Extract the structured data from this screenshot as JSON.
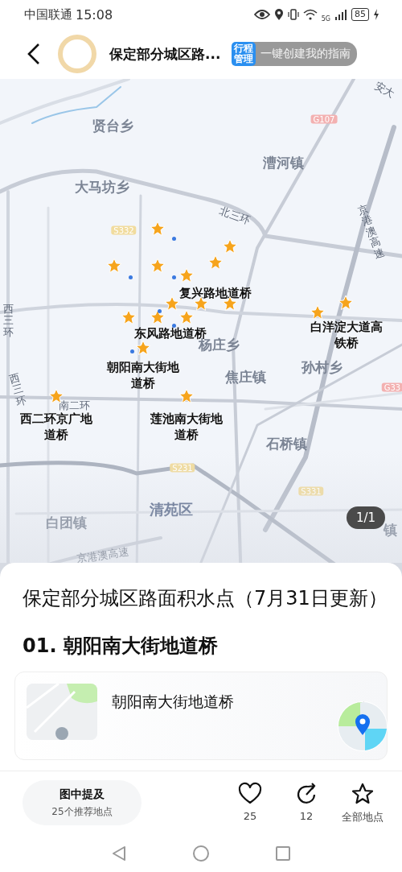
{
  "status_bar": {
    "carrier": "中国联通",
    "time": "15:08",
    "network": "5G",
    "battery": "85"
  },
  "header": {
    "title": "保定部分城区路...",
    "badge": "行程管理",
    "guide_button": "一键创建我的指南"
  },
  "map": {
    "labels": [
      {
        "text": "贤台乡",
        "kind": "place"
      },
      {
        "text": "G107",
        "kind": "national-route"
      },
      {
        "text": "安大",
        "kind": "road"
      },
      {
        "text": "漕河镇",
        "kind": "place"
      },
      {
        "text": "大马坊乡",
        "kind": "place"
      },
      {
        "text": "北三环",
        "kind": "road"
      },
      {
        "text": "S332",
        "kind": "provincial-route"
      },
      {
        "text": "京港澳高速",
        "kind": "road"
      },
      {
        "text": "复兴路地道桥",
        "kind": "poi"
      },
      {
        "text": "东风路地道桥",
        "kind": "poi"
      },
      {
        "text": "杨庄乡",
        "kind": "place"
      },
      {
        "text": "白洋淀大道高铁桥",
        "kind": "poi"
      },
      {
        "text": "朝阳南大街地道桥",
        "kind": "poi"
      },
      {
        "text": "焦庄镇",
        "kind": "place"
      },
      {
        "text": "孙村乡",
        "kind": "place"
      },
      {
        "text": "G33",
        "kind": "national-route"
      },
      {
        "text": "西三环",
        "kind": "road"
      },
      {
        "text": "西三环",
        "kind": "road"
      },
      {
        "text": "南二环",
        "kind": "road"
      },
      {
        "text": "西二环京广地道桥",
        "kind": "poi"
      },
      {
        "text": "莲池南大街地道桥",
        "kind": "poi"
      },
      {
        "text": "石桥镇",
        "kind": "place"
      },
      {
        "text": "S231",
        "kind": "provincial-route"
      },
      {
        "text": "S331",
        "kind": "provincial-route"
      },
      {
        "text": "清苑区",
        "kind": "district"
      },
      {
        "text": "白团镇",
        "kind": "place"
      },
      {
        "text": "镇",
        "kind": "place"
      },
      {
        "text": "京港澳高速",
        "kind": "road"
      }
    ],
    "page_indicator": "1/1"
  },
  "sheet": {
    "title": "保定部分城区路面积水点（7月31日更新）",
    "section_heading": "01. 朝阳南大街地道桥",
    "place_card": {
      "name": "朝阳南大街地道桥"
    }
  },
  "bottom_bar": {
    "mentioned": {
      "title": "图中提及",
      "subtitle": "25个推荐地点"
    },
    "actions": [
      {
        "kind": "like",
        "label": "25"
      },
      {
        "kind": "share",
        "label": "12"
      },
      {
        "kind": "save",
        "label": "全部地点"
      }
    ]
  }
}
